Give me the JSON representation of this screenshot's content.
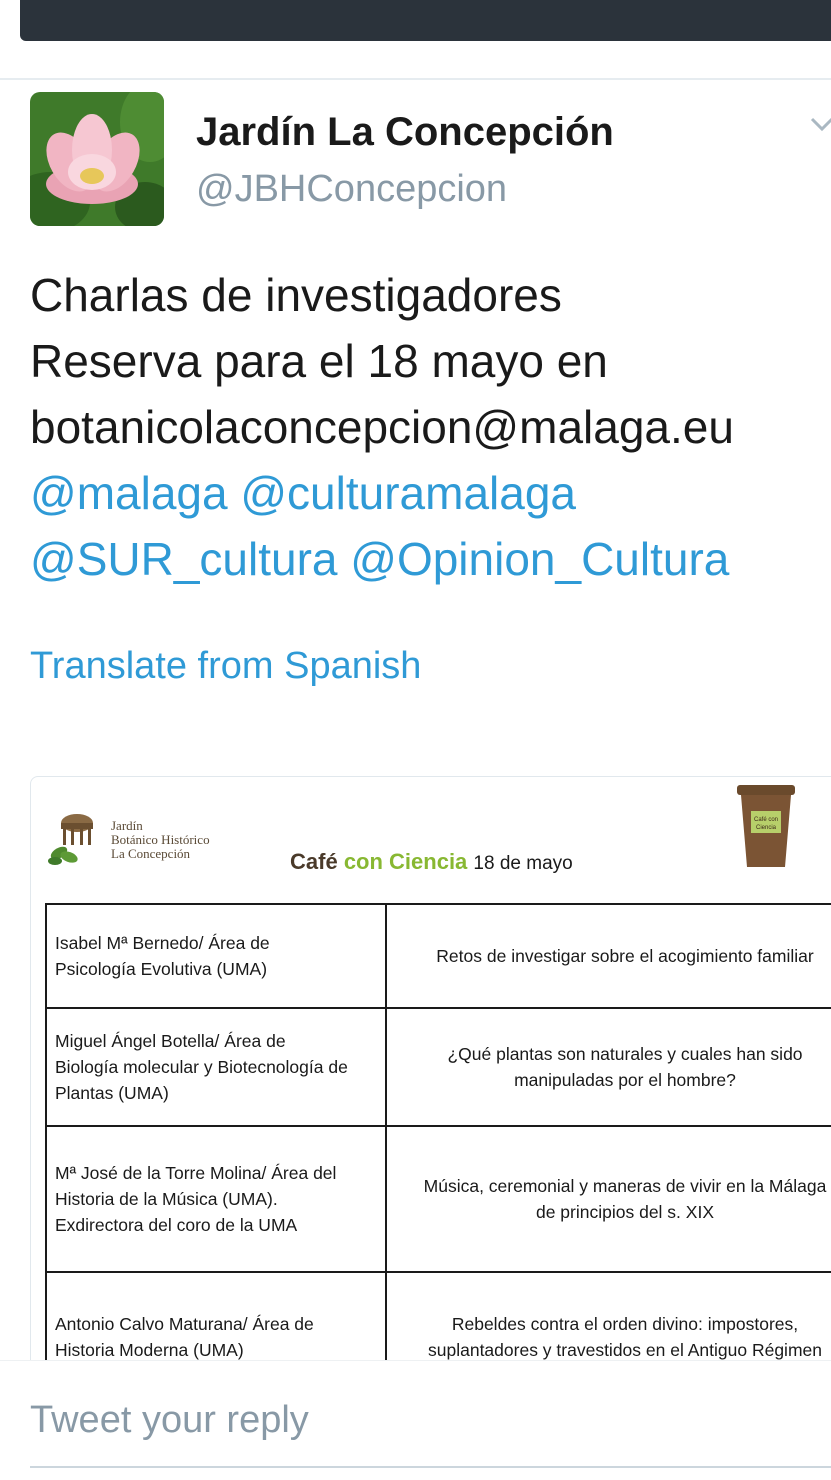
{
  "colors": {
    "accent": "#2f9ad6",
    "text_primary": "#1a1a1a",
    "text_secondary": "#8899a6",
    "topbar": "#2b333b"
  },
  "tweet": {
    "author_name": "Jardín La Concepción",
    "author_handle": "@JBHConcepcion",
    "avatar_icon": "lotus-flower-avatar",
    "text_lines": [
      "Charlas de investigadores",
      "Reserva para el 18 mayo en",
      "botanicolaconcepcion@malaga.eu"
    ],
    "mentions_line1": [
      "@malaga",
      "@culturamalaga"
    ],
    "mentions_line2": [
      "@SUR_cultura",
      "@Opinion_Cultura"
    ],
    "translate_label": "Translate from Spanish"
  },
  "media": {
    "logo_lines": [
      "Jardín",
      "Botánico Histórico",
      "La Concepción"
    ],
    "title_cafe": "Café",
    "title_ciencia": "con Ciencia",
    "title_date": "18 de mayo",
    "cup_label_top": "Café con",
    "cup_label_bottom": "Ciencia",
    "rows": [
      {
        "speaker": [
          "Isabel Mª Bernedo/ Área de",
          "Psicología Evolutiva (UMA)"
        ],
        "talk": [
          "Retos de investigar sobre el acogimiento familiar"
        ]
      },
      {
        "speaker": [
          "Miguel Ángel Botella/ Área de",
          "Biología molecular y Biotecnología de",
          "Plantas (UMA)"
        ],
        "talk": [
          "¿Qué plantas son naturales y cuales han sido",
          "manipuladas por el hombre?"
        ]
      },
      {
        "speaker": [
          "Mª José de la Torre Molina/ Área del",
          "Historia de la Música (UMA).",
          "Exdirectora del coro de la UMA"
        ],
        "talk": [
          "Música, ceremonial y maneras de vivir  en la Málaga",
          "de principios del s. XIX"
        ]
      },
      {
        "speaker": [
          "Antonio Calvo Maturana/ Área de",
          "Historia Moderna (UMA)"
        ],
        "talk": [
          "Rebeldes contra el orden divino: impostores,",
          "suplantadores y travestidos en el Antiguo Régimen"
        ]
      }
    ]
  },
  "reply": {
    "placeholder": "Tweet your reply"
  }
}
